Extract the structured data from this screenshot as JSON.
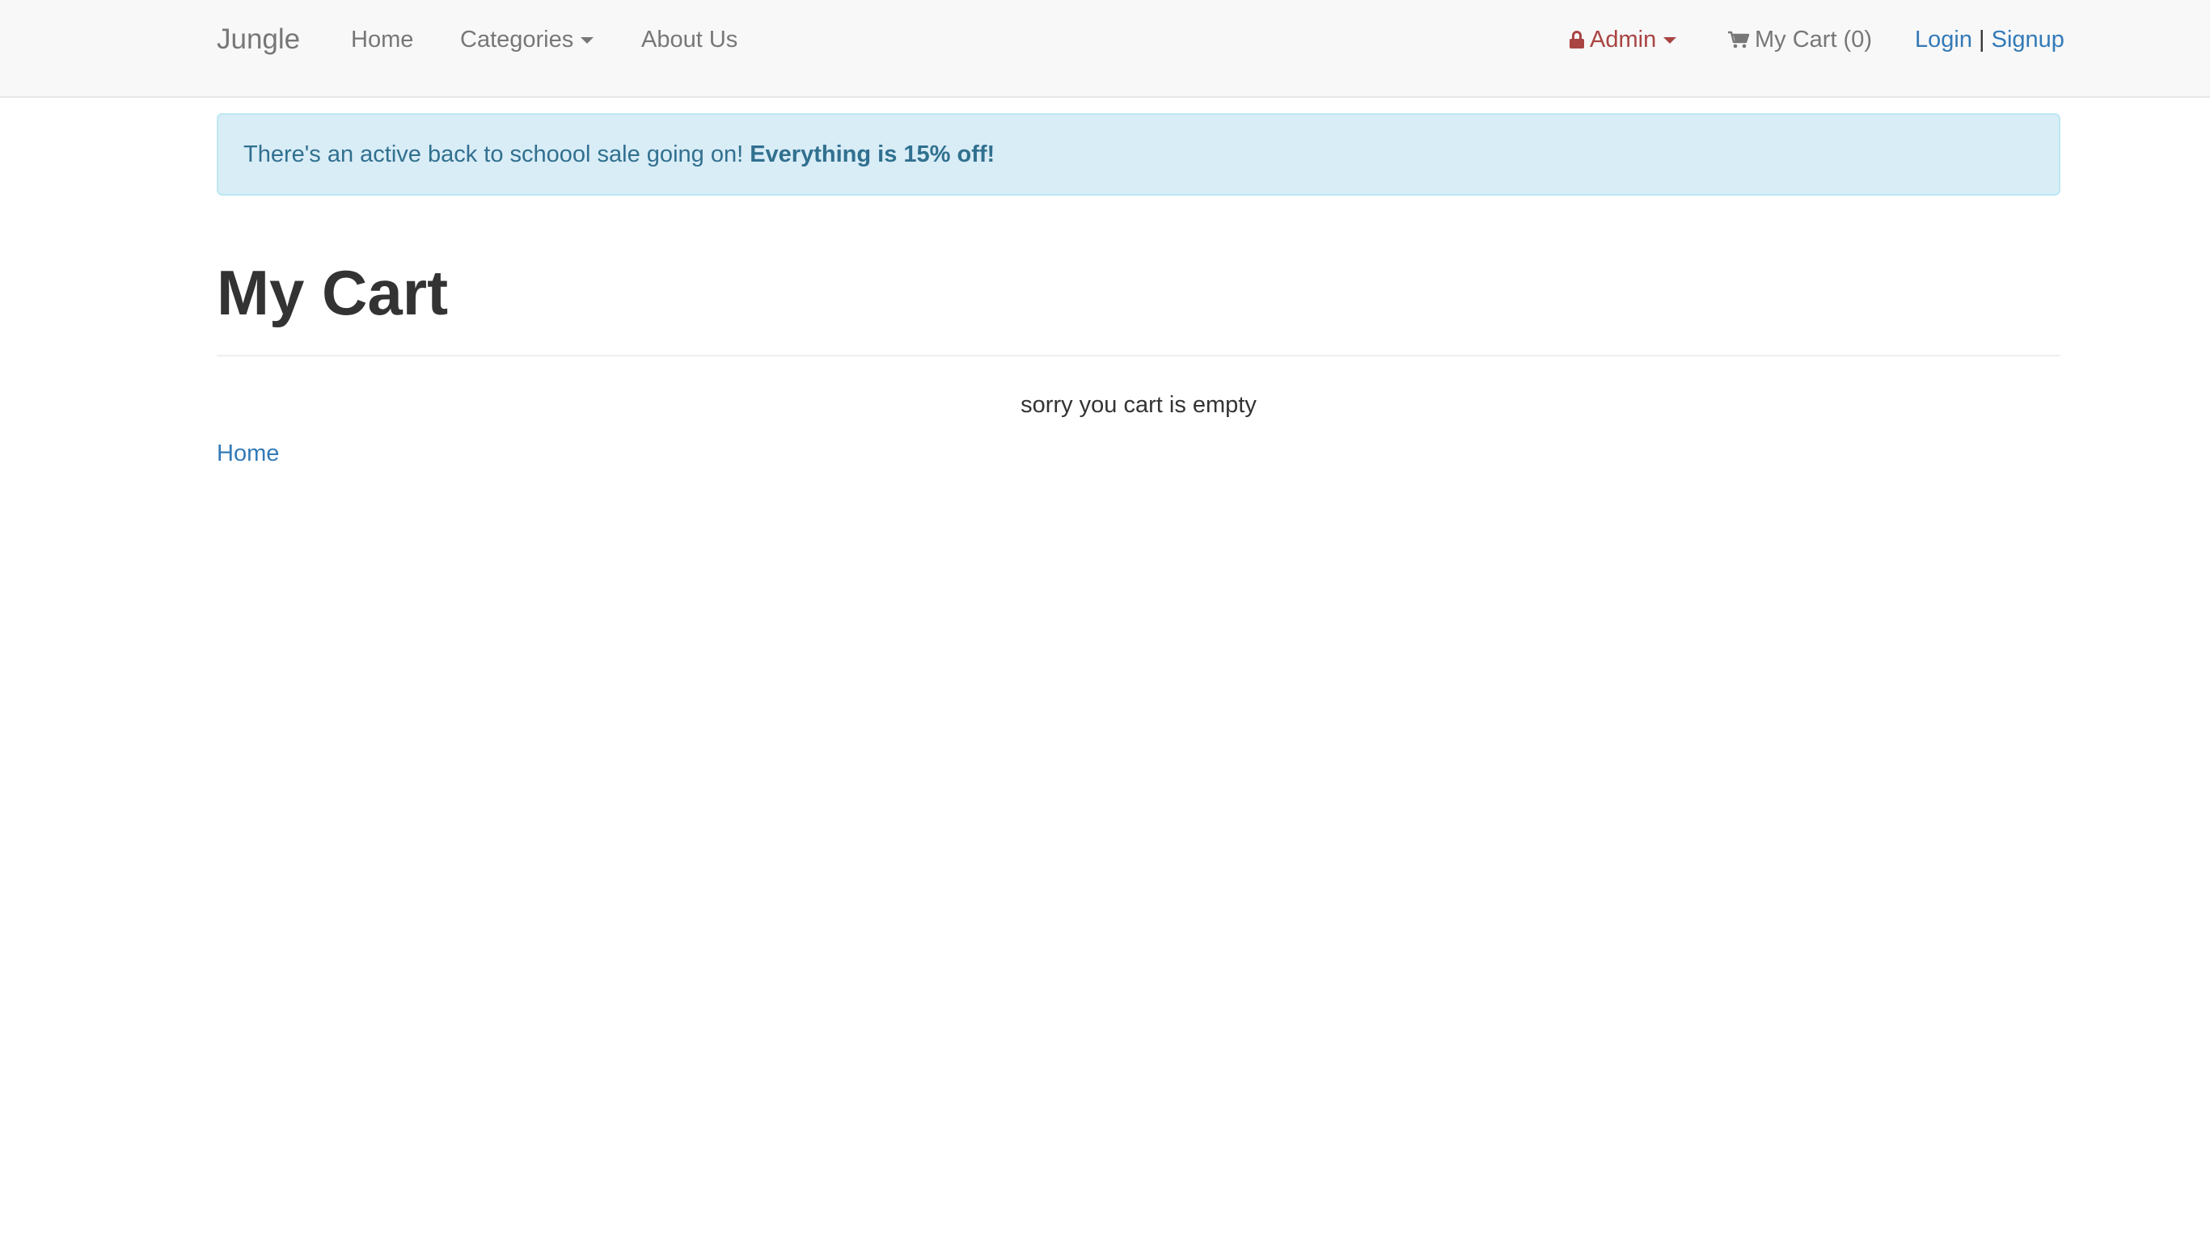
{
  "navbar": {
    "brand": "Jungle",
    "home": "Home",
    "categories": "Categories",
    "about": "About Us",
    "admin": "Admin",
    "cart": "My Cart (0)",
    "login": "Login",
    "separator": "|",
    "signup": "Signup"
  },
  "alert": {
    "text": "There's an active back to schoool sale going on! ",
    "emphasis": "Everything is 15% off!"
  },
  "main": {
    "title": "My Cart",
    "empty_message": "sorry you cart is empty",
    "home_link": "Home"
  },
  "icons": {
    "admin": "lock-icon",
    "cart": "shopping-cart-icon"
  },
  "colors": {
    "navbar_bg": "#f8f8f8",
    "nav_text": "#777777",
    "admin": "#a94442",
    "link": "#337ab7",
    "alert_bg": "#d9edf7",
    "alert_text": "#31708f"
  }
}
